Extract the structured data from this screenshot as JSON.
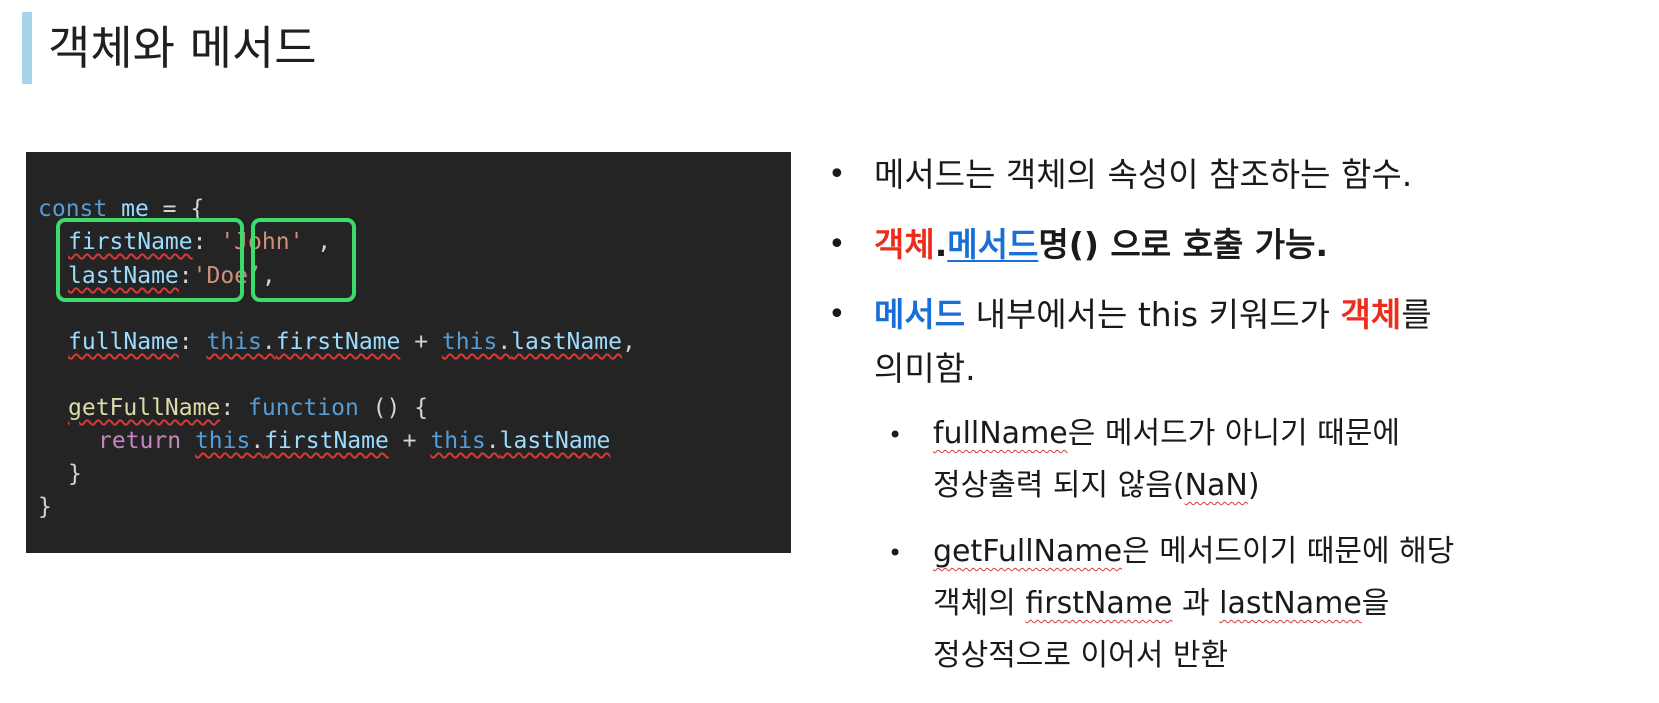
{
  "slide": {
    "title": "객체와 메서드"
  },
  "code": {
    "line1": {
      "kw": "const",
      "id": "me",
      "rest": " = {"
    },
    "line2": {
      "prop": "firstName",
      "colon": ": ",
      "value": "'John'",
      "tail": " ,"
    },
    "line3": {
      "prop": "lastName",
      "colon": ":",
      "value": "'Doe’",
      "tail": ","
    },
    "line4": {
      "prop": "fullName",
      "colon": ":",
      "this1": "this",
      "p1": "firstName",
      "plus": " + ",
      "this2": "this",
      "p2": "lastName",
      "tail": ","
    },
    "line5": {
      "prop": "getFullName",
      "colon": ":",
      "fn": "function",
      "rest": " () {"
    },
    "line6": {
      "ret": "return",
      "this1": "this",
      "p1": "firstName",
      "plus": " + ",
      "this2": "this",
      "p2": "lastName"
    },
    "line7": {
      "close": "}"
    },
    "line8": {
      "close": "}"
    },
    "dot": "."
  },
  "bullets": {
    "item1": "메서드는 객체의 속성이 참조하는 함수.",
    "item2": {
      "obj": "객체",
      "dot": ".",
      "method": "메서드",
      "rest": "명() 으로 호출 가능."
    },
    "item3": {
      "method": "메서드",
      "mid": " 내부에서는 this 키워드가 ",
      "obj": "객체",
      "tail": "를",
      "line2": "의미함."
    },
    "sub1": {
      "name": "fullName",
      "rest": "은 메서드가 아니기 때문에",
      "line2_pre": "정상출력 되지 않음(",
      "nan": "NaN",
      "line2_post": ")"
    },
    "sub2": {
      "name": "getFullName",
      "rest": "은 메서드이기 때문에 해당",
      "line2_pre": "객체의 ",
      "first": "firstName",
      "mid": " 과 ",
      "last": "lastName",
      "line2_post": "을",
      "line3": "정상적으로 이어서 반환"
    }
  },
  "colors": {
    "title_accent": "#a8d4ea",
    "code_background": "#242424",
    "highlight_box": "#3ddc6a",
    "red_emphasis": "#ec2d1b",
    "blue_emphasis": "#1a6fd6"
  }
}
